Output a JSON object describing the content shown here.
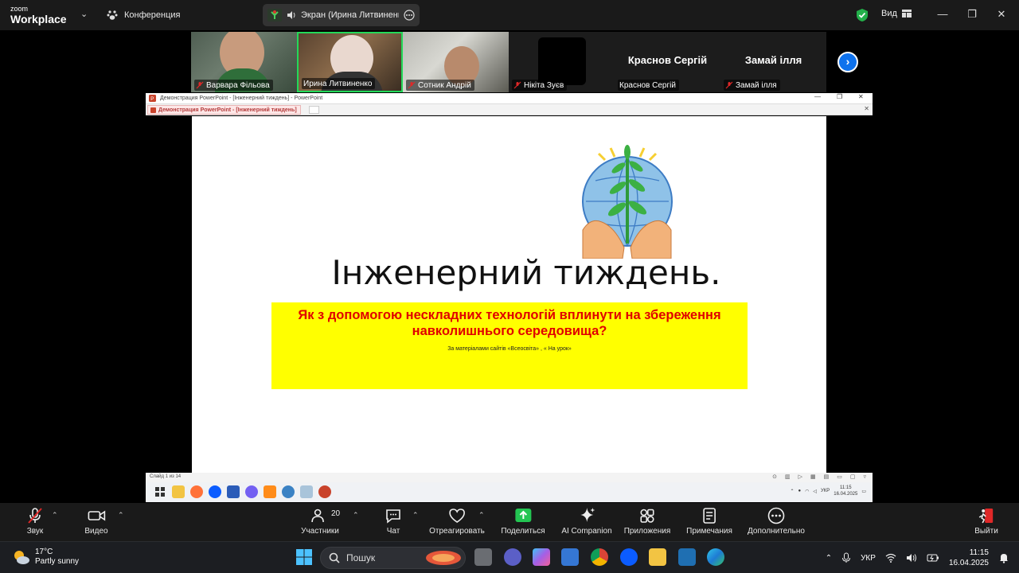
{
  "zoom": {
    "logo_small": "zoom",
    "logo_big": "Workplace",
    "meeting_label": "Конференция",
    "share_pill_label": "Экран (Ирина Литвиненко",
    "view_label": "Вид"
  },
  "participants": [
    {
      "name": "Варвара Фільова",
      "muted": true
    },
    {
      "name": "Ирина Литвиненко",
      "muted": false,
      "active": true
    },
    {
      "name": "Сотник Андрій",
      "muted": true
    },
    {
      "name": "Нікіта Зуєв",
      "muted": true
    },
    {
      "name": "Краснов Сергій",
      "display": "Краснов Сергій",
      "muted": false
    },
    {
      "name": "Замай ілля",
      "display": "Замай ілля",
      "muted": true
    }
  ],
  "powerpoint": {
    "window_title": "Демонстрация PowerPoint - [Інженерний тиждень] - PowerPoint",
    "tab_label": "Демонстрация PowerPoint - [Інженерний тиждень]",
    "slide_status": "Слайд 1 из 14"
  },
  "slide": {
    "title": "Інженерний тиждень.",
    "subtitle": "Як з допомогою нескладних технологій вплинути на збереження навколишнього середовища?",
    "source": "За матеріалами сайтів «Всеосвіта» , « На урок»"
  },
  "inner_taskbar": {
    "lang": "УКР",
    "time": "11:15",
    "date": "16.04.2025"
  },
  "toolbar": {
    "audio": "Звук",
    "video": "Видео",
    "participants": "Участники",
    "participants_count": "20",
    "chat": "Чат",
    "react": "Отреагировать",
    "share": "Поделиться",
    "ai": "AI Companion",
    "apps": "Приложения",
    "notes": "Примечания",
    "more": "Дополнительно",
    "leave": "Выйти"
  },
  "windows": {
    "temp": "17°C",
    "weather": "Partly sunny",
    "search_placeholder": "Пошук",
    "lang": "УКР",
    "time": "11:15",
    "date": "16.04.2025"
  },
  "colors": {
    "accent_green": "#23d959",
    "zoom_blue": "#0e72ed",
    "slide_yellow": "#ffff00",
    "slide_red": "#e00000",
    "leave_red": "#e02828"
  }
}
